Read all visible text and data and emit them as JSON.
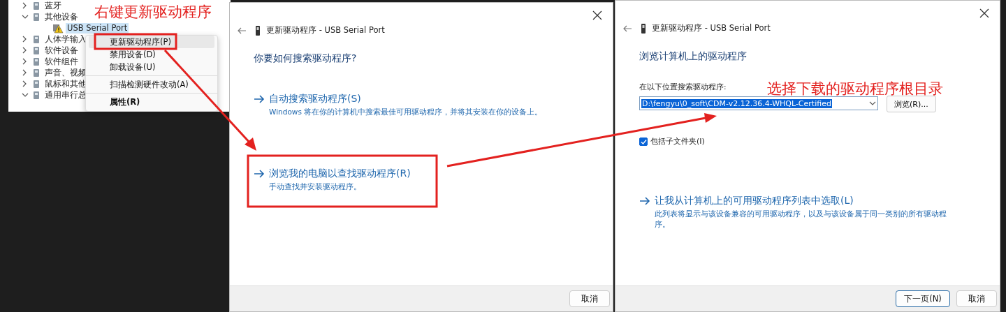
{
  "device_manager": {
    "tree": [
      {
        "label": "蓝牙",
        "expanded": false,
        "selected": false,
        "warning": false
      },
      {
        "label": "其他设备",
        "expanded": true,
        "selected": false,
        "warning": false,
        "children": [
          {
            "label": "USB Serial Port",
            "selected": true,
            "warning": true
          }
        ]
      },
      {
        "label": "人体学输入",
        "expanded": false,
        "selected": false,
        "warning": false
      },
      {
        "label": "软件设备",
        "expanded": false,
        "selected": false,
        "warning": false
      },
      {
        "label": "软件组件",
        "expanded": false,
        "selected": false,
        "warning": false
      },
      {
        "label": "声音、视频",
        "expanded": false,
        "selected": false,
        "warning": false
      },
      {
        "label": "鼠标和其他",
        "expanded": false,
        "selected": false,
        "warning": false
      },
      {
        "label": "通用串行总",
        "expanded": true,
        "selected": false,
        "warning": false
      }
    ]
  },
  "context_menu": {
    "groups": [
      [
        {
          "label": "更新驱动程序(P)",
          "selected": true,
          "bold": false
        },
        {
          "label": "禁用设备(D)",
          "selected": false,
          "bold": false
        },
        {
          "label": "卸载设备(U)",
          "selected": false,
          "bold": false
        }
      ],
      [
        {
          "label": "扫描检测硬件改动(A)",
          "selected": false,
          "bold": false
        }
      ],
      [
        {
          "label": "属性(R)",
          "selected": false,
          "bold": true
        }
      ]
    ]
  },
  "dialogs": [
    {
      "title": "更新驱动程序 - USB Serial Port",
      "blocks": [
        {
          "kind": "heading",
          "text": "你要如何搜索驱动程序?"
        },
        {
          "kind": "option",
          "title": "自动搜索驱动程序(S)",
          "description": "Windows 将在你的计算机中搜索最佳可用驱动程序，并将其安装在你的设备上。"
        },
        {
          "kind": "option",
          "title": "浏览我的电脑以查找驱动程序(R)",
          "description": "手动查找并安装驱动程序。"
        }
      ],
      "buttons": [
        {
          "label": "取消",
          "primary": false
        }
      ]
    },
    {
      "title": "更新驱动程序 - USB Serial Port",
      "blocks": [
        {
          "kind": "heading",
          "text": "浏览计算机上的驱动程序"
        },
        {
          "kind": "label",
          "text": "在以下位置搜索驱动程序:"
        },
        {
          "kind": "path",
          "value": "D:\\fengyu\\0_soft\\CDM-v2.12.36.4-WHQL-Certified",
          "selected": true,
          "button": "浏览(R)..."
        },
        {
          "kind": "checkbox",
          "text": "包括子文件夹(I)",
          "checked": true
        },
        {
          "kind": "option",
          "title": "让我从计算机上的可用驱动程序列表中选取(L)",
          "description": "此列表将显示与该设备兼容的可用驱动程序，以及与该设备属于同一类别的所有驱动程序。"
        }
      ],
      "buttons": [
        {
          "label": "下一页(N)",
          "primary": true
        },
        {
          "label": "取消",
          "primary": false
        }
      ]
    }
  ],
  "annotations": {
    "labels": [
      "右键更新驱动程序",
      "选择下载的驱动程序根目录"
    ]
  }
}
